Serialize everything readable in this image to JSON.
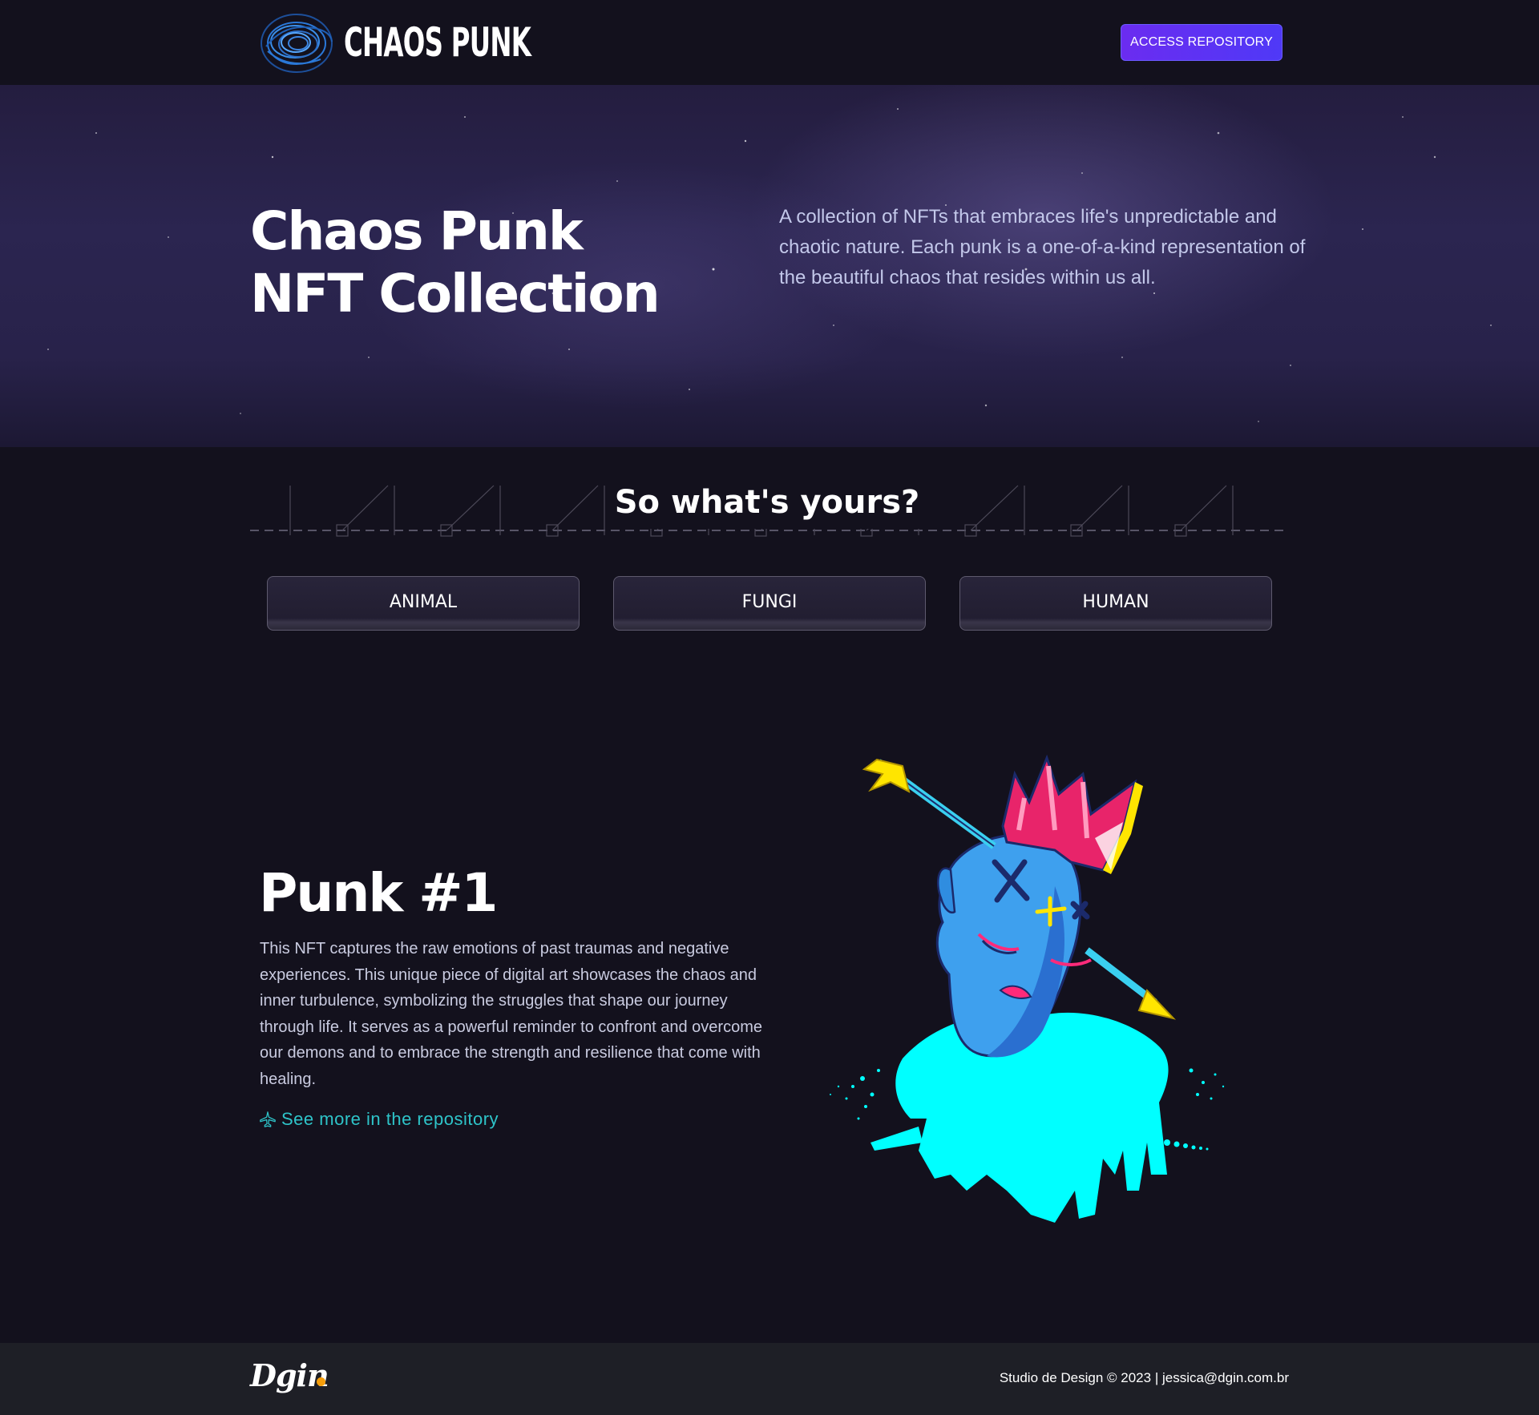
{
  "header": {
    "logo_text": "CHAOS PUNK",
    "cta_label": "ACCESS REPOSITORY"
  },
  "hero": {
    "title_line1": "Chaos Punk",
    "title_line2": "NFT Collection",
    "description": "A collection of NFTs that embraces life's unpredictable and chaotic nature. Each punk is a one-of-a-kind representation of the beautiful chaos that resides within us all."
  },
  "categories": {
    "title": "So what's yours?",
    "items": [
      "ANIMAL",
      "FUNGI",
      "HUMAN"
    ]
  },
  "punk": {
    "title": "Punk #1",
    "description": "This NFT captures the raw emotions of past traumas and negative experiences. This unique piece of digital art showcases the chaos and inner turbulence, symbolizing the struggles that shape our journey through life. It serves as a powerful reminder to confront and overcome our demons and to embrace the strength and resilience that come with healing.",
    "link_label": "See more in the repository"
  },
  "footer": {
    "logo": "Dgin",
    "text": "Studio de Design © 2023 | jessica@dgin.com.br"
  },
  "colors": {
    "background": "#13111d",
    "accent": "#5b36f5",
    "link": "#2ec4c9",
    "footer_bg": "#1e1f26",
    "footer_dot": "#f59d0a"
  }
}
